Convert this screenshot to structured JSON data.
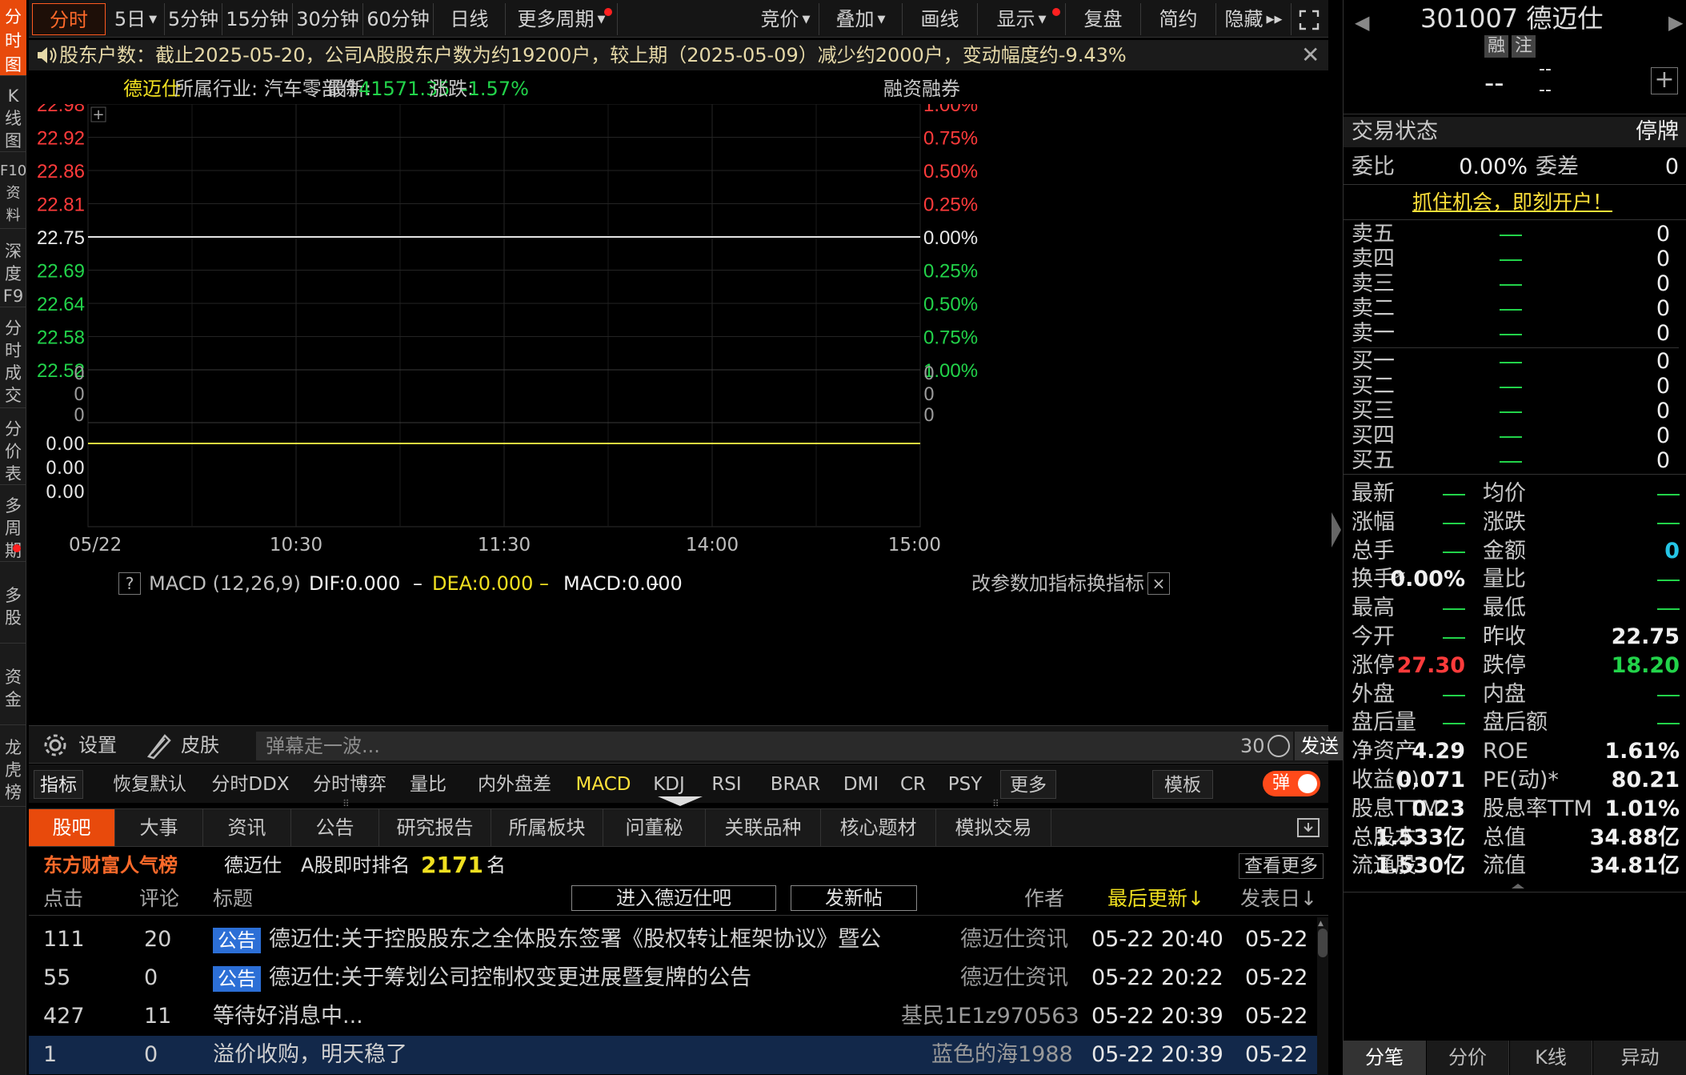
{
  "left_nav": [
    {
      "label": "分\n时\n图",
      "active": true
    },
    {
      "label": "K\n线\n图"
    },
    {
      "label": "F10\n资\n料"
    },
    {
      "label": "深\n度\nF9"
    },
    {
      "label": "分\n时\n成\n交"
    },
    {
      "label": "分\n价\n表"
    },
    {
      "label": "多\n周\n期"
    },
    {
      "label": "多\n股"
    },
    {
      "label": "资\n金"
    },
    {
      "label": "龙\n虎\n榜"
    }
  ],
  "toolbar": {
    "items": [
      "分时",
      "5日",
      "5分钟",
      "15分钟",
      "30分钟",
      "60分钟",
      "日线",
      "更多周期"
    ],
    "right_items": [
      "竞价",
      "叠加",
      "画线",
      "显示",
      "复盘",
      "简约",
      "隐藏"
    ]
  },
  "notice": {
    "text": "股东户数：截止2025-05-20，公司A股股东户数为约19200户，较上期（2025-05-09）减少约2000户，变动幅度约-9.43%"
  },
  "chart_header": {
    "name": "德迈仕",
    "industry": "所属行业: 汽车零部件",
    "latest_label": "最新:",
    "latest_value": "41571.35",
    "change_label": "涨跌:",
    "change_value": "-1.57%",
    "right_label": "融资融券"
  },
  "chart_data": {
    "type": "line",
    "title": "",
    "x_ticks": [
      "05/22",
      "10:30",
      "11:30",
      "14:00",
      "15:00"
    ],
    "y_left_ticks": [
      "22.98",
      "22.92",
      "22.86",
      "22.81",
      "22.75",
      "22.69",
      "22.64",
      "22.58",
      "22.52"
    ],
    "y_right_ticks": [
      "1.00%",
      "0.75%",
      "0.50%",
      "0.25%",
      "0.00%",
      "0.25%",
      "0.50%",
      "0.75%",
      "1.00%"
    ],
    "volume_ticks": [
      "0",
      "0",
      "0"
    ],
    "macd_ticks": [
      "0.00",
      "0.00",
      "0.00"
    ],
    "series": [
      {
        "values": [
          22.75,
          22.75
        ]
      }
    ],
    "ylim": [
      22.52,
      22.98
    ]
  },
  "macd": {
    "help": "?",
    "name": "MACD (12,26,9)",
    "dif": "DIF:0.000",
    "dea": "DEA:0.000",
    "macd": "MACD:0.000",
    "actions": [
      "改参数",
      "加指标",
      "换指标"
    ],
    "close": "×"
  },
  "danmu": {
    "settings": "设置",
    "skin": "皮肤",
    "placeholder": "弹幕走一波...",
    "count": "30",
    "send": "发送"
  },
  "indicators": {
    "items": [
      "指标",
      "恢复默认",
      "分时DDX",
      "分时博弈",
      "量比",
      "内外盘差",
      "MACD",
      "KDJ",
      "RSI",
      "BRAR",
      "DMI",
      "CR",
      "PSY",
      "更多",
      "模板"
    ],
    "toggle": "弹"
  },
  "bottom_tabs": [
    "股吧",
    "大事",
    "资讯",
    "公告",
    "研究报告",
    "所属板块",
    "问董秘",
    "关联品种",
    "核心题材",
    "模拟交易"
  ],
  "popularity": {
    "brand": "东方财富人气榜",
    "stock": "德迈仕",
    "rank_label": "A股即时排名",
    "rank": "2171",
    "unit": "名",
    "more": "查看更多"
  },
  "list_header": {
    "clicks": "点击",
    "comments": "评论",
    "title": "标题",
    "enter_btn": "进入德迈仕吧",
    "post_btn": "发新帖",
    "author": "作者",
    "latest": "最后更新↓",
    "posted": "发表日↓"
  },
  "posts": [
    {
      "clicks": "111",
      "comments": "20",
      "tag": "公告",
      "title": "德迈仕:关于控股股东之全体股东签署《股权转让框架协议》暨公",
      "author": "德迈仕资讯",
      "updated": "05-22 20:40",
      "date": "05-22"
    },
    {
      "clicks": "55",
      "comments": "0",
      "tag": "公告",
      "title": "德迈仕:关于筹划公司控制权变更进展暨复牌的公告",
      "author": "德迈仕资讯",
      "updated": "05-22 20:22",
      "date": "05-22"
    },
    {
      "clicks": "427",
      "comments": "11",
      "tag": "",
      "title": "等待好消息中...",
      "author": "基民1E1z970563",
      "updated": "05-22 20:39",
      "date": "05-22"
    },
    {
      "clicks": "1",
      "comments": "0",
      "tag": "",
      "title": "溢价收购，明天稳了",
      "author": "蓝色的海1988",
      "updated": "05-22 20:39",
      "date": "05-22"
    }
  ],
  "right_panel": {
    "code_name": "301007 德迈仕",
    "badges": [
      "融",
      "注"
    ],
    "price": "--",
    "change1": "--",
    "change2": "--",
    "status_label": "交易状态",
    "status_value": "停牌",
    "weibi_label": "委比",
    "weibi_value": "0.00%",
    "weicha_label": "委差",
    "weicha_value": "0",
    "promo": "抓住机会，即刻开户！",
    "sells": [
      {
        "label": "卖五",
        "vol": "0"
      },
      {
        "label": "卖四",
        "vol": "0"
      },
      {
        "label": "卖三",
        "vol": "0"
      },
      {
        "label": "卖二",
        "vol": "0"
      },
      {
        "label": "卖一",
        "vol": "0"
      }
    ],
    "buys": [
      {
        "label": "买一",
        "vol": "0"
      },
      {
        "label": "买二",
        "vol": "0"
      },
      {
        "label": "买三",
        "vol": "0"
      },
      {
        "label": "买四",
        "vol": "0"
      },
      {
        "label": "买五",
        "vol": "0"
      }
    ],
    "stats": [
      {
        "k1": "最新",
        "v1": "",
        "k2": "均价",
        "v2": ""
      },
      {
        "k1": "涨幅",
        "v1": "",
        "k2": "涨跌",
        "v2": ""
      },
      {
        "k1": "总手",
        "v1": "",
        "k2": "金额",
        "v2": "0"
      },
      {
        "k1": "换手*",
        "v1": "0.00%",
        "k2": "量比",
        "v2": ""
      },
      {
        "k1": "最高",
        "v1": "",
        "k2": "最低",
        "v2": ""
      },
      {
        "k1": "今开",
        "v1": "",
        "k2": "昨收",
        "v2": "22.75"
      },
      {
        "k1": "涨停",
        "v1": "27.30",
        "k2": "跌停",
        "v2": "18.20"
      },
      {
        "k1": "外盘",
        "v1": "",
        "k2": "内盘",
        "v2": ""
      },
      {
        "k1": "盘后量",
        "v1": "",
        "k2": "盘后额",
        "v2": ""
      },
      {
        "k1": "净资产",
        "v1": "4.29",
        "k2": "ROE",
        "v2": "1.61%"
      },
      {
        "k1": "收益(-)",
        "v1": "0.071",
        "k2": "PE(动)*",
        "v2": "80.21"
      },
      {
        "k1": "股息TTM",
        "v1": "0.23",
        "k2": "股息率TTM",
        "v2": "1.01%"
      },
      {
        "k1": "总股本",
        "v1": "1.533亿",
        "k2": "总值",
        "v2": "34.88亿"
      },
      {
        "k1": "流通股",
        "v1": "1.530亿",
        "k2": "流值",
        "v2": "34.81亿"
      }
    ],
    "tabs": [
      "分笔",
      "分价",
      "K线",
      "异动"
    ]
  },
  "colors": {
    "accent": "#e84a0c",
    "up": "#ff3b3b",
    "down": "#22d34a",
    "macd_dea": "#f0e020"
  }
}
